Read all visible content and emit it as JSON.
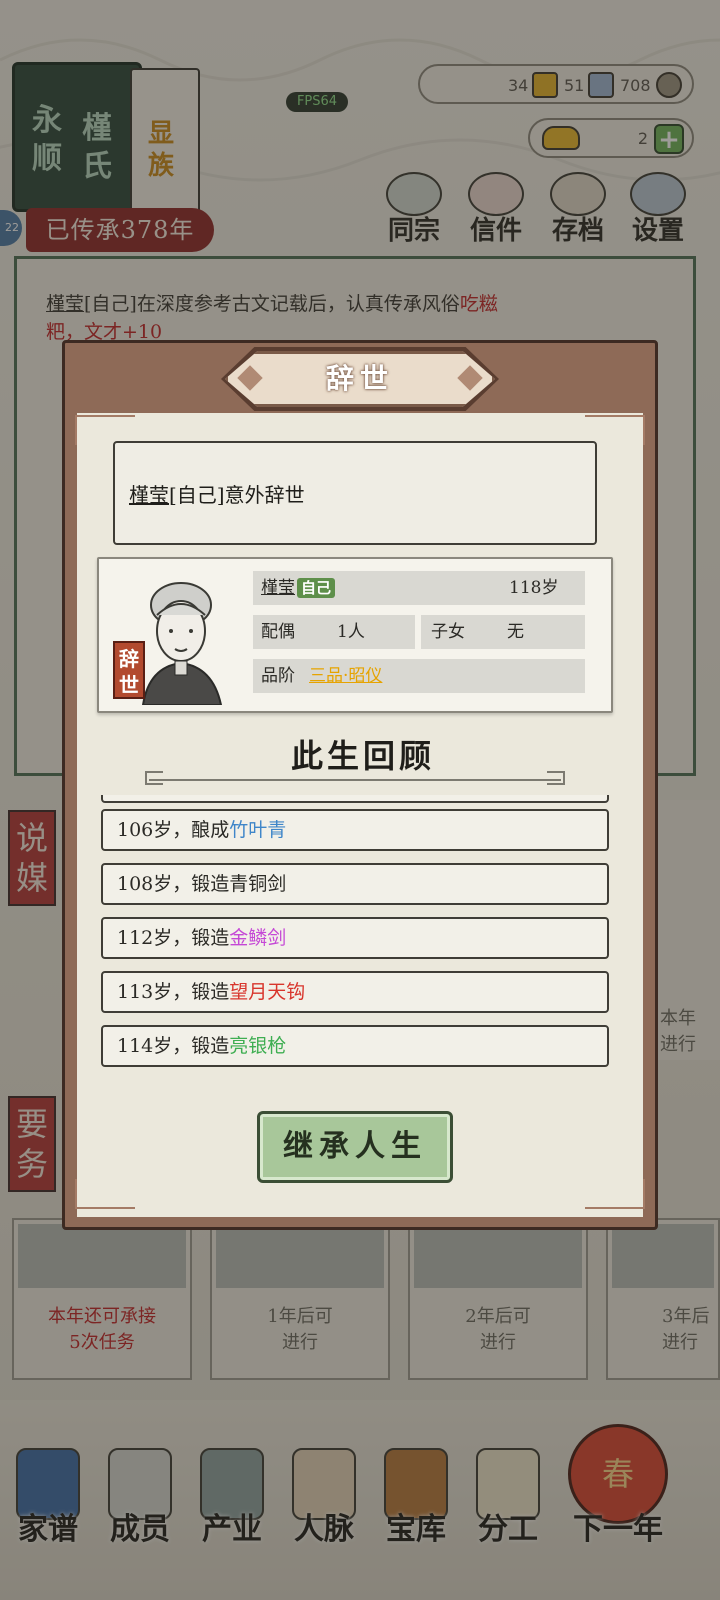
{
  "clan": {
    "name_col1": "永顺",
    "name_col2": "槿氏",
    "rank_badge": "显族",
    "inherit_years": "已传承378年"
  },
  "fps": "FPS64",
  "resources": {
    "res1": "34",
    "res2": "51",
    "res3": "708",
    "gold": "2",
    "add": "+"
  },
  "side_badge": "22",
  "top_nav": [
    {
      "label": "同宗",
      "icon": "clan-books-icon"
    },
    {
      "label": "信件",
      "icon": "letter-icon"
    },
    {
      "label": "存档",
      "icon": "save-scroll-icon"
    },
    {
      "label": "设置",
      "icon": "settings-gear-icon"
    }
  ],
  "event_log": {
    "line1_name": "槿莹",
    "line1_rest": "[自己]在深度参考古文记载后，认真传承风俗",
    "line1_red": "吃糍",
    "line2": "粑，文才+10"
  },
  "side_tags": {
    "matchmaking": "说媒",
    "duties": "要务"
  },
  "task_cards": [
    {
      "text1": "本年还可承接",
      "text2": "5次任务"
    },
    {
      "text1": "1年后可",
      "text2": "进行"
    },
    {
      "text1": "2年后可",
      "text2": "进行"
    },
    {
      "text1": "3年后",
      "text2": "进行"
    }
  ],
  "right_card_top": {
    "text1": "本年",
    "text2": "进行"
  },
  "bottom_nav": [
    {
      "label": "家谱",
      "icon": "genealogy-book-icon"
    },
    {
      "label": "成员",
      "icon": "member-portrait-icon"
    },
    {
      "label": "产业",
      "icon": "industry-building-icon"
    },
    {
      "label": "人脉",
      "icon": "network-icon"
    },
    {
      "label": "宝库",
      "icon": "treasure-chest-icon"
    },
    {
      "label": "分工",
      "icon": "assignment-scroll-icon"
    },
    {
      "label": "下一年",
      "icon": "spring-lantern-icon"
    }
  ],
  "lantern_char": "春",
  "modal": {
    "title": "辞世",
    "message_name": "槿莹",
    "message_rest": "[自己]意外辞世",
    "profile": {
      "name": "槿莹",
      "self_label": "自己",
      "age": "118岁",
      "spouse_label": "配偶",
      "spouse_value": "1人",
      "children_label": "子女",
      "children_value": "无",
      "rank_label": "品阶",
      "rank_value": "三品·昭仪",
      "status_tag": "辞世"
    },
    "review_title": "此生回顾",
    "life_events": [
      {
        "age": "106岁，",
        "verb": "酿成",
        "item": "竹叶青",
        "color": "#3f86c9"
      },
      {
        "age": "108岁，",
        "verb": "锻造青铜剑",
        "item": "",
        "color": "#2b2a26"
      },
      {
        "age": "112岁，",
        "verb": "锻造",
        "item": "金鳞剑",
        "color": "#c548d6"
      },
      {
        "age": "113岁，",
        "verb": "锻造",
        "item": "望月天钩",
        "color": "#d8352c"
      },
      {
        "age": "114岁，",
        "verb": "锻造",
        "item": "亮银枪",
        "color": "#3fae52"
      }
    ],
    "inherit_button": "继承人生"
  }
}
